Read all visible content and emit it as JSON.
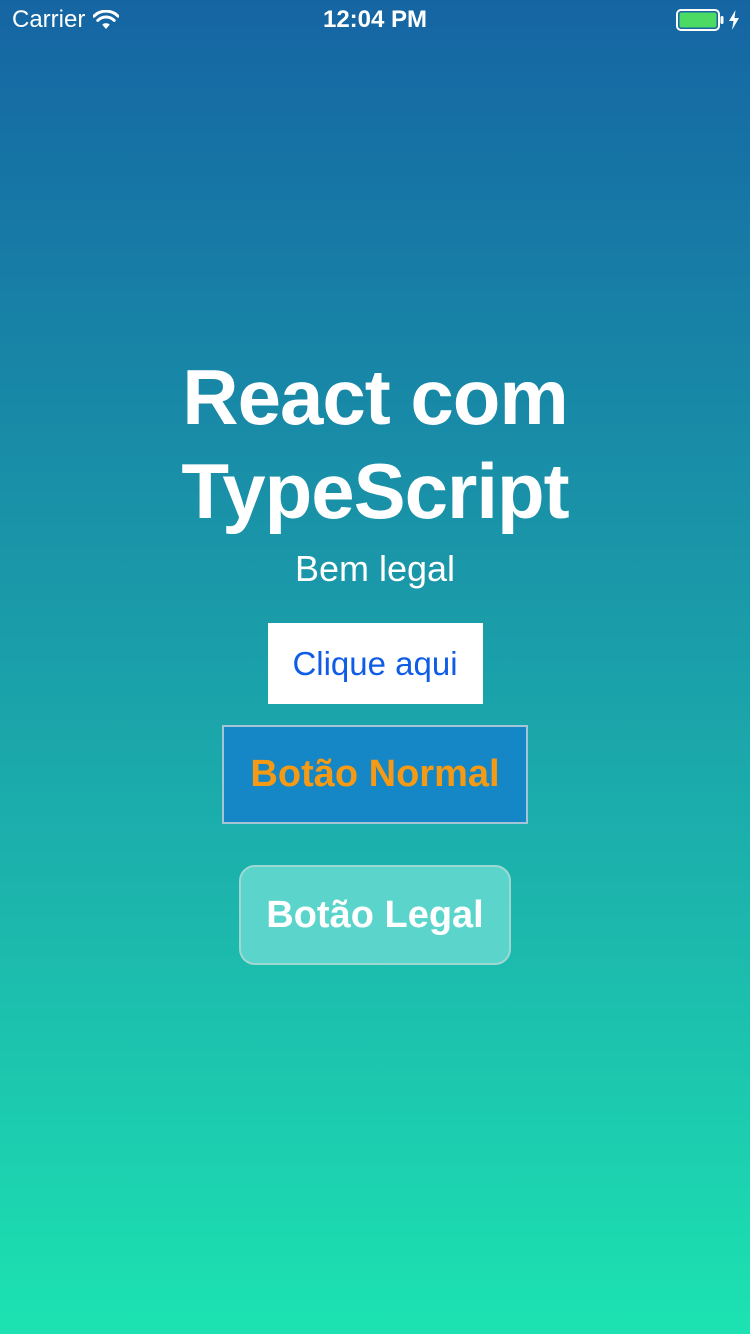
{
  "status_bar": {
    "carrier": "Carrier",
    "time": "12:04 PM",
    "battery_level": 1.0,
    "charging": true,
    "icons": [
      "wifi-icon",
      "battery-icon",
      "charging-bolt-icon"
    ],
    "battery_color": "#4cd964"
  },
  "main": {
    "title": "React com TypeScript",
    "subtitle": "Bem legal"
  },
  "buttons": {
    "clique": {
      "label": "Clique aqui",
      "text_color": "#0f5ce6",
      "background": "#ffffff"
    },
    "normal": {
      "label": "Botão Normal",
      "text_color": "#f59a14",
      "background": "#1586c6"
    },
    "legal": {
      "label": "Botão Legal",
      "text_color": "#ffffff",
      "background": "#5bd5cc"
    }
  },
  "colors": {
    "gradient_top": "#1565a3",
    "gradient_bottom": "#1ce3b1"
  }
}
